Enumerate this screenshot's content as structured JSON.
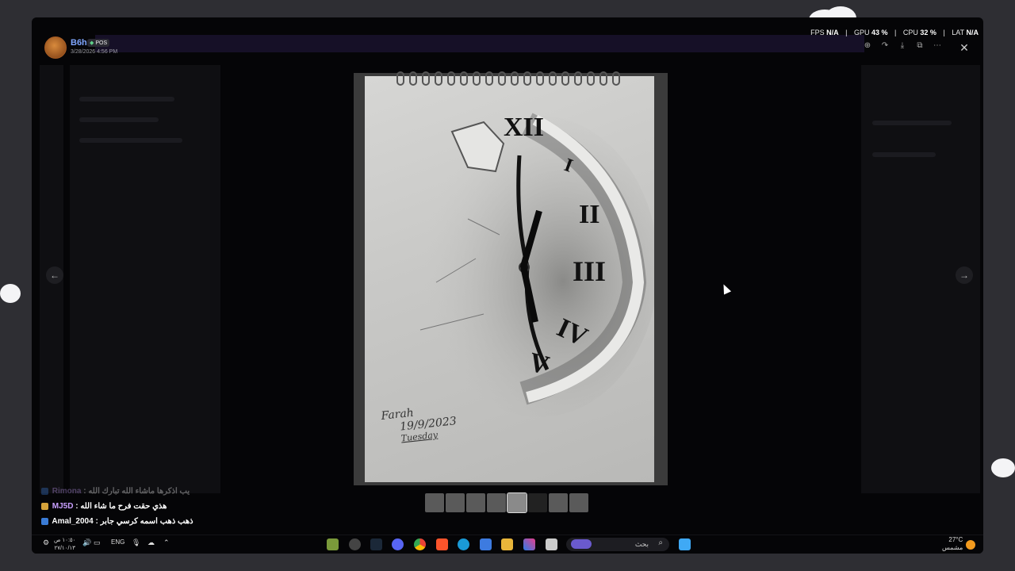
{
  "post": {
    "username": "B6h",
    "tag": "POS",
    "timestamp": "3/28/2026 4:56 PM"
  },
  "stats": {
    "fps_label": "FPS",
    "fps": "N/A",
    "gpu_label": "GPU",
    "gpu": "43 %",
    "cpu_label": "CPU",
    "cpu": "32 %",
    "lat_label": "LAT",
    "lat": "N/A"
  },
  "icons": {
    "zoom": "zoom-icon",
    "forward": "forward-icon",
    "download": "download-icon",
    "open": "open-external-icon",
    "more": "more-icon",
    "close": "close-icon",
    "prev": "arrow-left-icon",
    "next": "arrow-right-icon"
  },
  "drawing": {
    "signature": "Farah",
    "date": "19/9/2023",
    "day": "Tuesday"
  },
  "chat": [
    {
      "user": "Rimona",
      "text": "يب اذكرها ماشاء الله تبارك الله"
    },
    {
      "user": "MJ5D",
      "text": "هذي حقت فرح ما شاء الله"
    },
    {
      "user": "Amal_2004",
      "text": "ذهب ذهب اسمه كرسي جابر"
    }
  ],
  "taskbar": {
    "time": "١٠:٥٠ ص",
    "date": "٢٧/١٠/١٣",
    "lang": "ENG",
    "search_placeholder": "بحث",
    "weather_temp": "27°C",
    "weather_desc": "مشمس"
  },
  "colors": {
    "accent": "#7fa6ff",
    "chat_user": "#c9a0ff",
    "background": "#2e2e33"
  }
}
